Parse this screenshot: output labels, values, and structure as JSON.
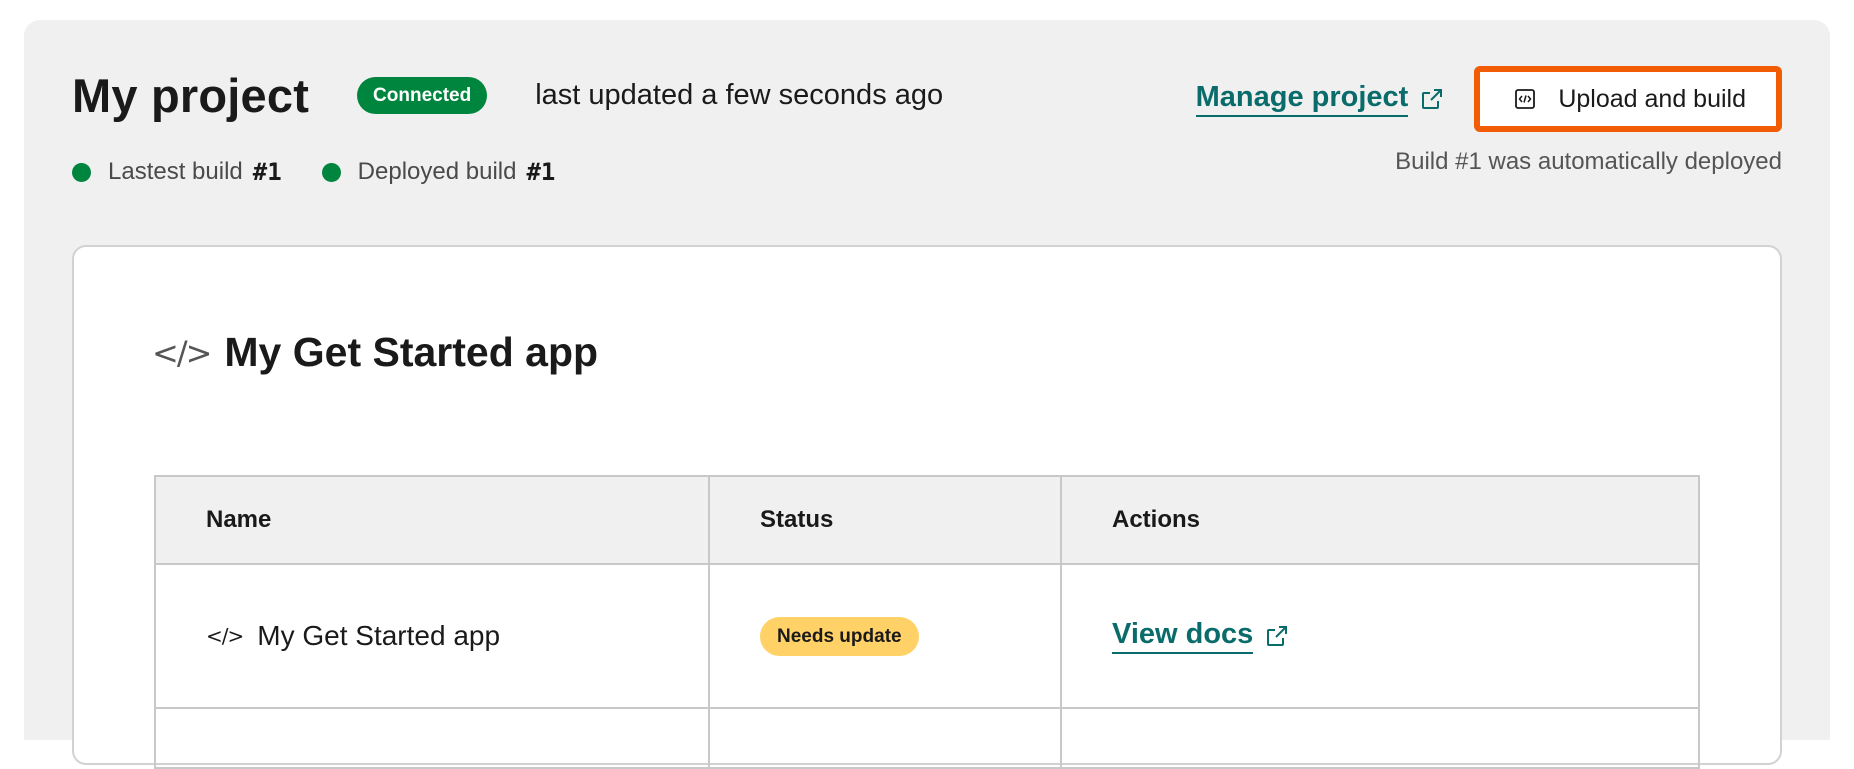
{
  "header": {
    "title": "My project",
    "badge": "Connected",
    "updated": "last updated a few seconds ago",
    "manage_link": "Manage project",
    "upload_button": "Upload and build",
    "deploy_note": "Build #1 was automatically deployed"
  },
  "builds": {
    "latest_label": "Lastest build",
    "latest_value": "#1",
    "deployed_label": "Deployed build",
    "deployed_value": "#1"
  },
  "app": {
    "title": "My Get Started app",
    "columns": [
      "Name",
      "Status",
      "Actions"
    ],
    "rows": [
      {
        "name": "My Get Started app",
        "status": "Needs update",
        "action": "View docs"
      }
    ]
  },
  "colors": {
    "accent_green": "#00853f",
    "link_teal": "#0a6b6b",
    "highlight_orange": "#f25c05",
    "warning_yellow": "#ffd166"
  },
  "icons": {
    "external_link": "external-link-icon",
    "code": "code-icon",
    "code_box": "code-box-icon"
  }
}
